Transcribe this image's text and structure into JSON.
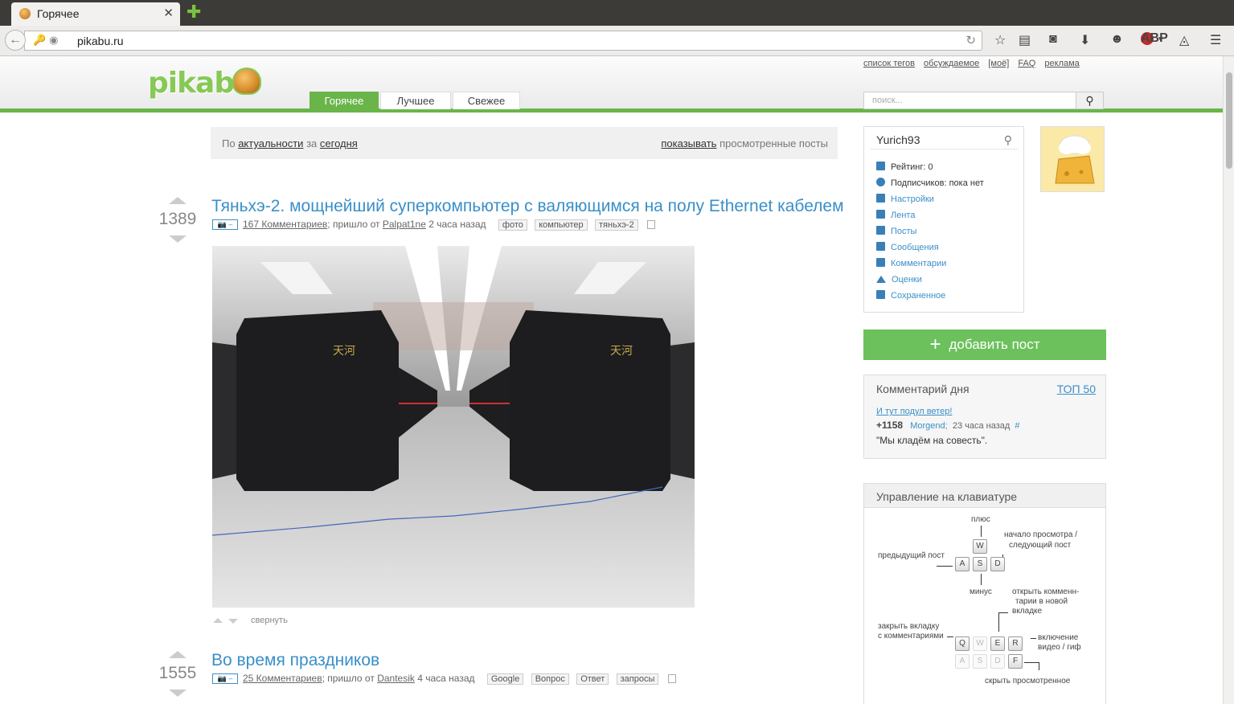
{
  "browser": {
    "tab_title": "Горячее",
    "url": "pikabu.ru"
  },
  "header": {
    "logo_text": "pikabu",
    "toplinks": [
      "список тегов",
      "обсуждаемое",
      "[моё]",
      "FAQ",
      "реклама"
    ],
    "tabs": [
      "Горячее",
      "Лучшее",
      "Свежее"
    ],
    "search_placeholder": "поиск..."
  },
  "filter": {
    "by": "По",
    "sort": "актуальности",
    "for": "за",
    "period": "сегодня",
    "show": "показывать",
    "viewed": "просмотренные посты"
  },
  "posts": [
    {
      "rating": "1389",
      "title": "Тяньхэ-2. мощнейший суперкомпьютер с валяющимся на полу Ethernet кабелем",
      "comments": "167 Комментариев",
      "came_from": "; пришло от",
      "author": "Palpat1ne",
      "time": "2 часа назад",
      "tags": [
        "фото",
        "компьютер",
        "тяньхэ-2"
      ],
      "collapse": "свернуть"
    },
    {
      "rating": "1555",
      "title": "Во время праздников",
      "comments": "25 Комментариев",
      "came_from": "; пришло от",
      "author": "Dantesik",
      "time": "4 часа назад",
      "tags": [
        "Google",
        "Вопрос",
        "Ответ",
        "запросы"
      ]
    }
  ],
  "sidebar": {
    "username": "Yurich93",
    "rating": "Рейтинг: 0",
    "subscribers": "Подписчиков: пока нет",
    "menu": [
      "Настройки",
      "Лента",
      "Посты",
      "Сообщения",
      "Комментарии",
      "Оценки",
      "Сохраненное"
    ],
    "add_post": "добавить пост",
    "comment_of_day": {
      "title": "Комментарий дня",
      "top": "ТОП 50",
      "link": "И тут подул ветер!",
      "score": "+1158",
      "author": "Morgend;",
      "time": "23 часа назад",
      "hash": "#",
      "quote": "\"Мы кладём на совесть\"."
    },
    "keyboard": {
      "title": "Управление на клавиатуре",
      "plus": "плюс",
      "next": "начало просмотра /",
      "next2": "следующий пост",
      "prev": "предыдущий пост",
      "minus": "минус",
      "open_comments1": "открыть комменн-",
      "open_comments2": "тарии в новой",
      "open_comments3": "вкладке",
      "close_tab1": "закрыть вкладку",
      "close_tab2": "с комментариями",
      "video1": "включение",
      "video2": "видео / гиф",
      "hide_viewed": "скрыть просмотренное",
      "keys": [
        "W",
        "A",
        "S",
        "D",
        "Q",
        "W",
        "E",
        "R",
        "A",
        "S",
        "D",
        "F"
      ]
    }
  },
  "colors": {
    "green": "#6ab54a",
    "link_blue": "#3a8fc8"
  }
}
